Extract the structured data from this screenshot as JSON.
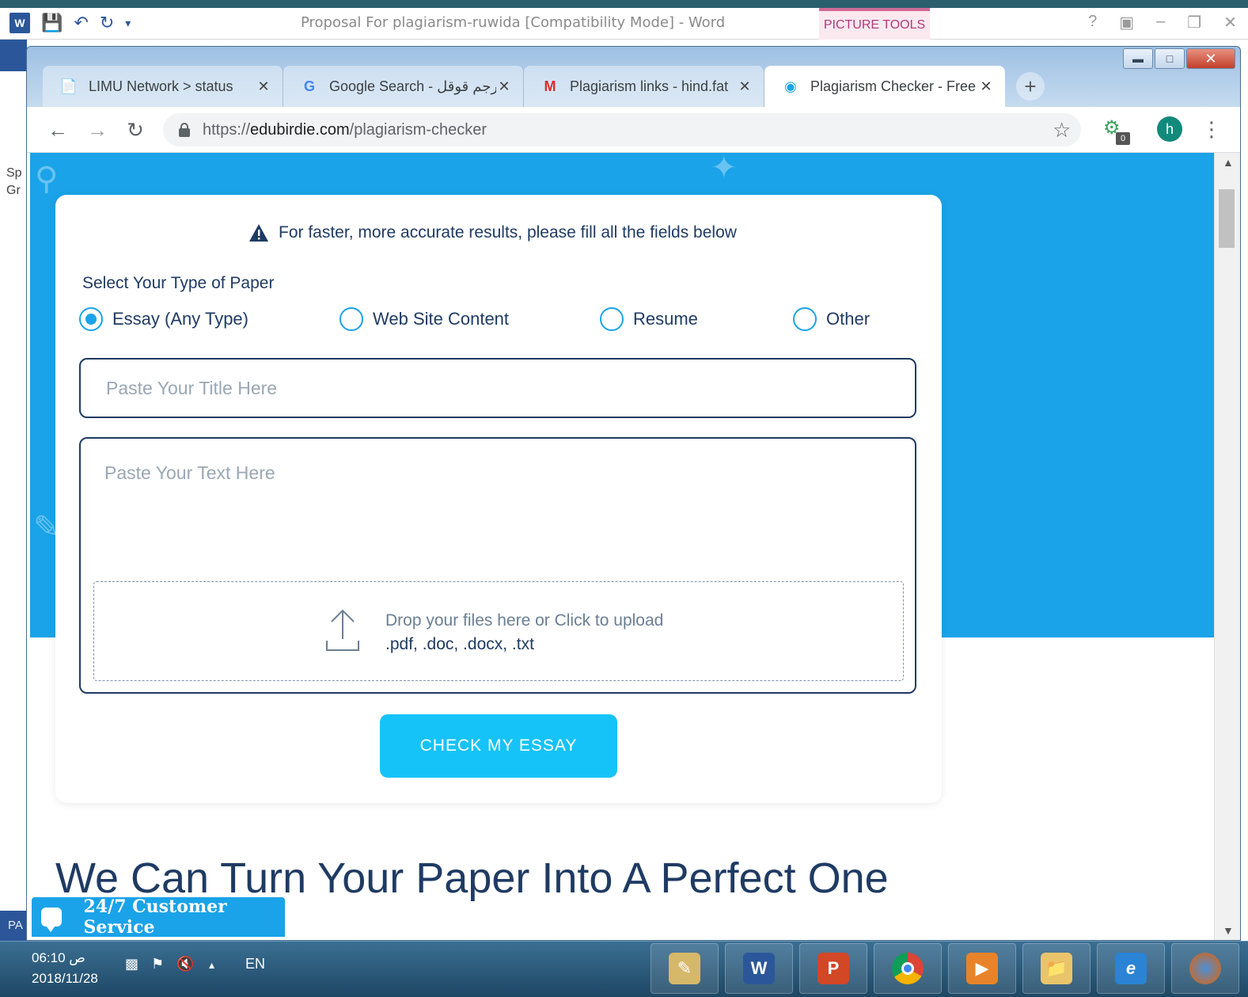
{
  "word": {
    "title": "Proposal For plagiarism-ruwida [Compatibility Mode] - Word",
    "picture_tools": "PICTURE TOOLS",
    "left_text_1": "Sp",
    "left_text_2": "Gr",
    "status_left": "PA"
  },
  "chrome": {
    "tabs": [
      {
        "title": "LIMU Network > status",
        "icon": "page-icon"
      },
      {
        "title": "Google Search - مترجم قوقل",
        "icon": "google-icon"
      },
      {
        "title": "Plagiarism links - hind.fat",
        "icon": "gmail-icon"
      },
      {
        "title": "Plagiarism Checker - Free",
        "icon": "edubirdie-icon"
      }
    ],
    "url_prefix": "https://",
    "url_domain": "edubirdie.com",
    "url_path": "/plagiarism-checker",
    "extension_badge": "0",
    "avatar_letter": "h"
  },
  "page": {
    "notice": "For faster, more accurate results, please fill all the fields below",
    "paper_label": "Select Your Type of Paper",
    "paper_types": [
      {
        "label": "Essay (Any Type)",
        "checked": true
      },
      {
        "label": "Web Site Content",
        "checked": false
      },
      {
        "label": "Resume",
        "checked": false
      },
      {
        "label": "Other",
        "checked": false
      }
    ],
    "title_placeholder": "Paste Your Title Here",
    "text_placeholder": "Paste Your Text Here",
    "drop_text": "Drop your files here or Click to upload",
    "drop_types": ".pdf, .doc, .docx, .txt",
    "check_button": "CHECK MY ESSAY",
    "headline": "We Can Turn Your Paper Into A Perfect One",
    "chat_label": "24/7 Customer Service"
  },
  "taskbar": {
    "time": "06:10 ص",
    "date": "2018/11/28",
    "lang": "EN"
  },
  "colors": {
    "brand_blue": "#1aa3e8",
    "button_cyan": "#16c3f8",
    "text_navy": "#1f3b63"
  }
}
